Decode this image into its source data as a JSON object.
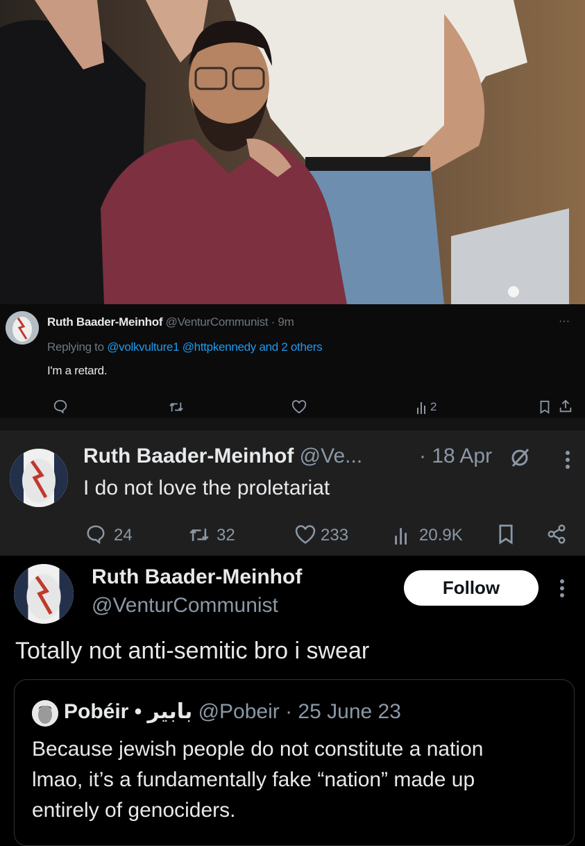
{
  "tweet_reply": {
    "display_name": "Ruth Baader-Meinhof",
    "handle": "@VenturCommunist",
    "time": "· 9m",
    "replying_prefix": "Replying to",
    "replying_user1": "@volkvulture1",
    "replying_user2": "@httpkennedy",
    "replying_suffix": "and 2 others",
    "text": "I'm a retard.",
    "more": "···",
    "views": "2"
  },
  "tweet_middle": {
    "display_name": "Ruth Baader-Meinhof",
    "handle": "@Ve...",
    "date": "· 18 Apr",
    "text": "I do not love the proletariat",
    "replies": "24",
    "reposts": "32",
    "likes": "233",
    "views": "20.9K"
  },
  "tweet_main": {
    "display_name": "Ruth Baader-Meinhof",
    "handle": "@VenturCommunist",
    "follow_label": "Follow",
    "text": "Totally not anti-semitic bro i swear"
  },
  "quoted_tweet": {
    "display_name": "Pobéir • بابير",
    "handle": "@Pobeir",
    "date": "· 25 June 23",
    "text_line1": "Because jewish people do not constitute a nation",
    "text_line2": "lmao, it’s a fundamentally fake “nation” made up",
    "text_line3": "entirely of genociders."
  },
  "colors": {
    "accent_blue": "#1d9bf0",
    "muted": "#8b98a5",
    "card_bg": "#1f1f20"
  }
}
